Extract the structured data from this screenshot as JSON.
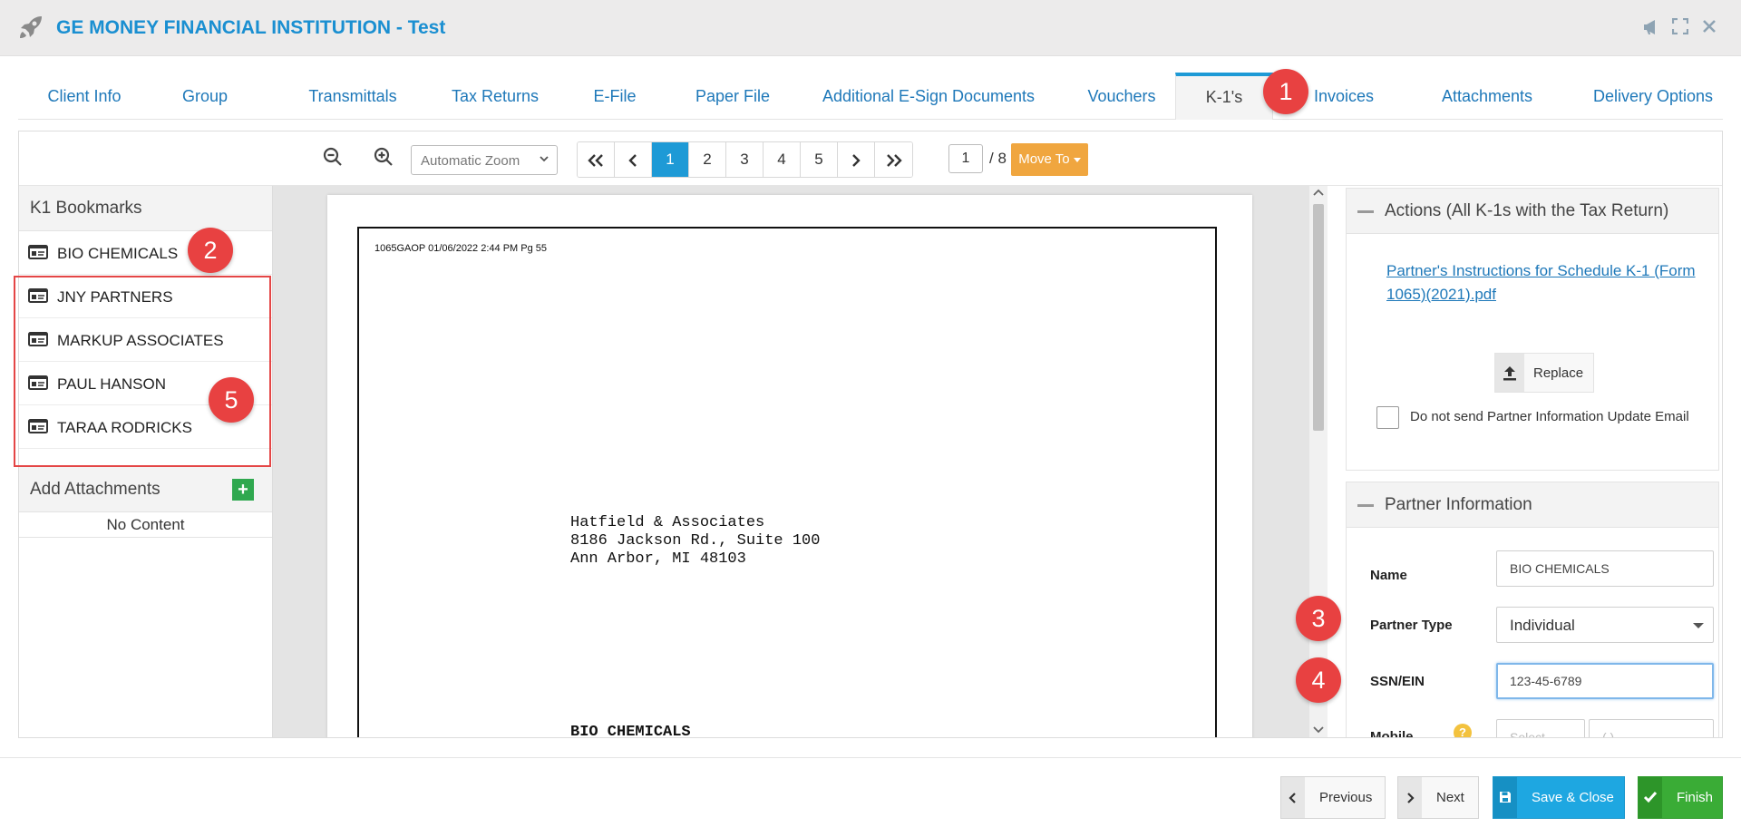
{
  "app": {
    "title": "GE MONEY FINANCIAL INSTITUTION - Test"
  },
  "tabs": [
    {
      "label": "Client Info"
    },
    {
      "label": "Group"
    },
    {
      "label": "Transmittals"
    },
    {
      "label": "Tax Returns"
    },
    {
      "label": "E-File"
    },
    {
      "label": "Paper File"
    },
    {
      "label": "Additional E-Sign Documents"
    },
    {
      "label": "Vouchers"
    },
    {
      "label": "K-1's"
    },
    {
      "label": "Invoices"
    },
    {
      "label": "Attachments"
    },
    {
      "label": "Delivery Options"
    }
  ],
  "badges": [
    "1",
    "2",
    "3",
    "4",
    "5"
  ],
  "toolbar": {
    "zoom_value": "Automatic Zoom",
    "pages": [
      "1",
      "2",
      "3",
      "4",
      "5"
    ],
    "current_page_input": "1",
    "page_total": "/ 8",
    "move_to_label": "Move To"
  },
  "bookmarks": {
    "title": "K1 Bookmarks",
    "items": [
      {
        "label": "BIO CHEMICALS"
      },
      {
        "label": "JNY PARTNERS"
      },
      {
        "label": "MARKUP ASSOCIATES"
      },
      {
        "label": "PAUL HANSON"
      },
      {
        "label": "TARAA RODRICKS"
      }
    ]
  },
  "attachments": {
    "title": "Add Attachments",
    "empty_text": "No Content"
  },
  "document": {
    "stamp": "1065GAOP 01/06/2022 2:44 PM Pg 55",
    "address_line1": "Hatfield & Associates",
    "address_line2": "8186 Jackson Rd., Suite 100",
    "address_line3": "Ann Arbor, MI 48103",
    "partner_name": "BIO CHEMICALS"
  },
  "actions": {
    "title": "Actions (All K-1s with the Tax Return)",
    "instructions_link": "Partner's Instructions for Schedule K-1 (Form 1065)(2021).pdf",
    "replace_label": "Replace",
    "no_email_label": "Do not send Partner Information Update Email",
    "no_email_checked": false
  },
  "partner_info": {
    "title": "Partner Information",
    "name_label": "Name",
    "name_value": "BIO CHEMICALS",
    "type_label": "Partner Type",
    "type_value": "Individual",
    "ssn_label": "SSN/EIN",
    "ssn_value": "123-45-6789",
    "mobile_label": "Mobile",
    "mobile_select_placeholder": "Select",
    "mobile_number_placeholder": "( ) -"
  },
  "footer": {
    "previous_label": "Previous",
    "next_label": "Next",
    "save_close_label": "Save & Close",
    "finish_label": "Finish"
  },
  "colors": {
    "accent": "#1e9ad6",
    "brand_title": "#1a8fd1",
    "badge": "#e84141",
    "move_to": "#f0a63f",
    "save": "#1ea7e1",
    "finish": "#3aac36"
  }
}
